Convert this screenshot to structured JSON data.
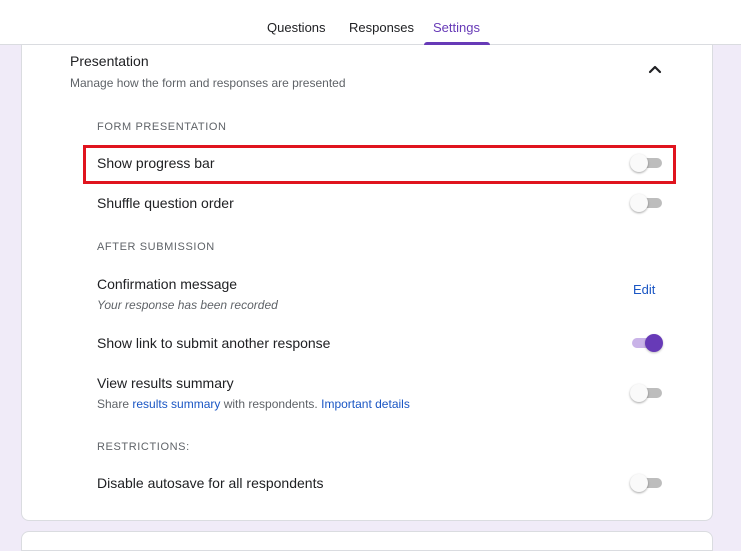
{
  "tabs": [
    {
      "label": "Questions"
    },
    {
      "label": "Responses"
    },
    {
      "label": "Settings"
    }
  ],
  "presentation": {
    "title": "Presentation",
    "subtitle": "Manage how the form and responses are presented"
  },
  "form_presentation": {
    "header": "FORM PRESENTATION",
    "show_progress_bar": {
      "label": "Show progress bar",
      "on": false
    },
    "shuffle_question_order": {
      "label": "Shuffle question order",
      "on": false
    }
  },
  "after_submission": {
    "header": "AFTER SUBMISSION",
    "confirmation": {
      "label": "Confirmation message",
      "value": "Your response has been recorded",
      "edit_label": "Edit"
    },
    "show_link": {
      "label": "Show link to submit another response",
      "on": true
    },
    "view_results": {
      "label": "View results summary",
      "desc_prefix": "Share ",
      "desc_link": "results summary",
      "desc_mid": " with respondents. ",
      "desc_link2": "Important details",
      "on": false
    }
  },
  "restrictions": {
    "header": "RESTRICTIONS:",
    "disable_autosave": {
      "label": "Disable autosave for all respondents",
      "on": false
    }
  },
  "colors": {
    "accent": "#673ab7",
    "link": "#1a56c4",
    "highlight": "#e0141e",
    "page_bg": "#f0ebf8"
  },
  "icons": {
    "collapse": "chevron-up-icon"
  }
}
